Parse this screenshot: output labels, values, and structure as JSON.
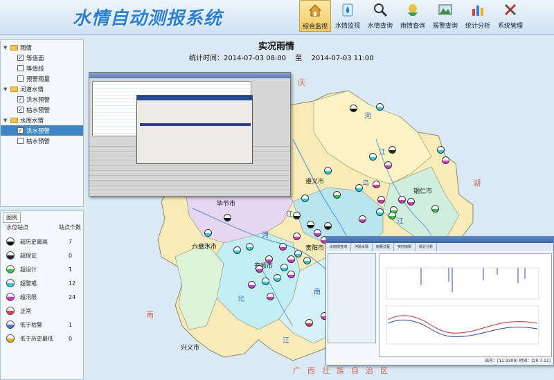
{
  "app": {
    "title": "水情自动测报系统"
  },
  "nav": {
    "items": [
      {
        "label": "综合监视",
        "icon": "home-icon",
        "active": true
      },
      {
        "label": "水情监视",
        "icon": "water-drop-icon",
        "active": false
      },
      {
        "label": "水情查询",
        "icon": "magnifier-icon",
        "active": false
      },
      {
        "label": "雨情查询",
        "icon": "rain-icon",
        "active": false
      },
      {
        "label": "报警查询",
        "icon": "landscape-icon",
        "active": false
      },
      {
        "label": "统计分析",
        "icon": "bar-chart-icon",
        "active": false
      },
      {
        "label": "系统管理",
        "icon": "tools-icon",
        "active": false
      }
    ]
  },
  "tree": {
    "nodes": [
      {
        "label": "雨情",
        "level": 0,
        "type": "folder"
      },
      {
        "label": "等值面",
        "level": 1,
        "type": "check",
        "checked": true
      },
      {
        "label": "等值线",
        "level": 1,
        "type": "check",
        "checked": false
      },
      {
        "label": "预警雨量",
        "level": 1,
        "type": "check",
        "checked": false
      },
      {
        "label": "河道水情",
        "level": 0,
        "type": "folder"
      },
      {
        "label": "洪水预警",
        "level": 1,
        "type": "check",
        "checked": true
      },
      {
        "label": "枯水预警",
        "level": 1,
        "type": "check",
        "checked": true
      },
      {
        "label": "水库水情",
        "level": 0,
        "type": "folder"
      },
      {
        "label": "洪水预警",
        "level": 1,
        "type": "check",
        "checked": true,
        "selected": true
      },
      {
        "label": "枯水预警",
        "level": 1,
        "type": "check",
        "checked": false
      }
    ]
  },
  "legend": {
    "tab": "图例",
    "col_station": "水位站点",
    "col_count": "站点个数",
    "rows": [
      {
        "label": "超历史最高",
        "count": "7",
        "color": "#111111"
      },
      {
        "label": "超保证",
        "count": "0",
        "color": "#222222"
      },
      {
        "label": "超设计",
        "count": "1",
        "color": "#2ecc40"
      },
      {
        "label": "超警戒",
        "count": "12",
        "color": "#22d3e8"
      },
      {
        "label": "超汛限",
        "count": "24",
        "color": "#e02fd0"
      },
      {
        "label": "正常",
        "count": "",
        "color": "#e04040"
      },
      {
        "label": "低于枯警",
        "count": "1",
        "color": "#4a6fd8"
      },
      {
        "label": "低于历史最低",
        "count": "0",
        "color": "#f0b020"
      }
    ]
  },
  "map": {
    "title": "实况雨情",
    "time_label": "统计时间：2014-07-03 08:00",
    "time_sep": "至",
    "time_end": "2014-07-03 11:00",
    "cities": [
      {
        "label": "遵义市"
      },
      {
        "label": "毕节市"
      },
      {
        "label": "六盘水市"
      },
      {
        "label": "安顺市"
      },
      {
        "label": "贵阳市"
      },
      {
        "label": "铜仁市"
      },
      {
        "label": "兴义市"
      }
    ],
    "provinces": [
      "庆",
      "湖",
      "南",
      "广西壮族自治区"
    ],
    "rivers": [
      "河",
      "江",
      "乌",
      "江",
      "河",
      "江",
      "北",
      "南",
      "江"
    ]
  },
  "screens": {
    "win2_tabs": [
      "水雨情查询",
      "河道水情",
      "雨量过程",
      "实时雨情",
      "统计分析"
    ],
    "win2_status": "站号：[11.3309]   时间：[20.7.11]"
  }
}
